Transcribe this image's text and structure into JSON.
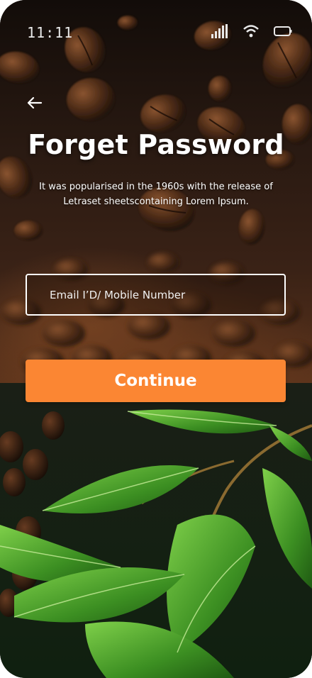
{
  "status_bar": {
    "time": "11:11",
    "icons": [
      "signal-icon",
      "wifi-icon",
      "battery-icon"
    ]
  },
  "header": {
    "back_icon": "back-arrow-icon",
    "title": "Forget Password",
    "subtitle": "It was popularised in the 1960s with the release of Letraset sheetscontaining Lorem Ipsum."
  },
  "form": {
    "identifier_placeholder": "Email I’D/ Mobile Number",
    "identifier_value": "",
    "continue_label": "Continue"
  },
  "colors": {
    "accent": "#fb8633",
    "text": "#ffffff",
    "input_border": "#ffffff"
  },
  "background": {
    "top": "coffee beans",
    "bottom": "coffee leaves"
  }
}
